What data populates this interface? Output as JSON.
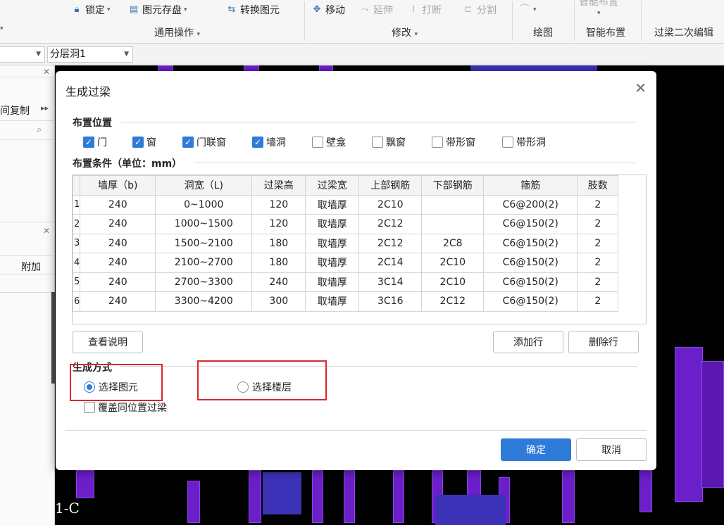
{
  "ribbon": {
    "lock": "锁定",
    "save_element": "图元存盘",
    "convert_element": "转换图元",
    "move": "移动",
    "extend": "延伸",
    "break": "打断",
    "split": "分割",
    "smart_layout_top": "智能布置",
    "groups": {
      "common_ops": "通用操作",
      "modify": "修改",
      "draw": "绘图",
      "smart_layout": "智能布置",
      "lintel_secondary_edit": "过梁二次编辑"
    }
  },
  "toolbar2": {
    "combo1_value": "",
    "combo2_value": "分层洞1"
  },
  "left_panel": {
    "copy_label": "间复制",
    "expand_icon": "double-chevron-right-icon",
    "col_header": "附加"
  },
  "viewport": {
    "axis_label": "1-C"
  },
  "dialog": {
    "title": "生成过梁",
    "section_position": "布置位置",
    "checkboxes": [
      {
        "label": "门",
        "checked": true
      },
      {
        "label": "窗",
        "checked": true
      },
      {
        "label": "门联窗",
        "checked": true
      },
      {
        "label": "墙洞",
        "checked": true
      },
      {
        "label": "壁龛",
        "checked": false
      },
      {
        "label": "飘窗",
        "checked": false
      },
      {
        "label": "带形窗",
        "checked": false
      },
      {
        "label": "带形洞",
        "checked": false
      }
    ],
    "section_conditions": "布置条件（单位：mm）",
    "table": {
      "headers": [
        "墙厚（b)",
        "洞宽（L)",
        "过梁高",
        "过梁宽",
        "上部钢筋",
        "下部钢筋",
        "箍筋",
        "肢数"
      ],
      "rows": [
        [
          "1",
          "240",
          "0~1000",
          "120",
          "取墙厚",
          "2C10",
          "",
          "C6@200(2)",
          "2"
        ],
        [
          "2",
          "240",
          "1000~1500",
          "120",
          "取墙厚",
          "2C12",
          "",
          "C6@150(2)",
          "2"
        ],
        [
          "3",
          "240",
          "1500~2100",
          "180",
          "取墙厚",
          "2C12",
          "2C8",
          "C6@150(2)",
          "2"
        ],
        [
          "4",
          "240",
          "2100~2700",
          "180",
          "取墙厚",
          "2C14",
          "2C10",
          "C6@150(2)",
          "2"
        ],
        [
          "5",
          "240",
          "2700~3300",
          "240",
          "取墙厚",
          "3C14",
          "2C10",
          "C6@150(2)",
          "2"
        ],
        [
          "6",
          "240",
          "3300~4200",
          "300",
          "取墙厚",
          "3C16",
          "2C12",
          "C6@150(2)",
          "2"
        ]
      ]
    },
    "btn_view_desc": "查看说明",
    "btn_add_row": "添加行",
    "btn_delete_row": "删除行",
    "section_method": "生成方式",
    "radio_select_element": "选择图元",
    "radio_select_floor": "选择楼层",
    "radio_selected": "select_element",
    "cover_checkbox": "覆盖同位置过梁",
    "btn_ok": "确定",
    "btn_cancel": "取消"
  },
  "colors": {
    "primary": "#2f7bd9",
    "highlight_box": "#d9262c",
    "viewport_bg": "#000000",
    "model_purple": "#6a1fc8"
  }
}
